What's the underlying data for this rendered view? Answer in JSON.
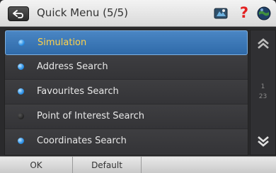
{
  "header": {
    "title": "Quick Menu (5/5)",
    "help_glyph": "?"
  },
  "menu": {
    "items": [
      {
        "label": "Simulation",
        "selected": true,
        "enabled": true
      },
      {
        "label": "Address Search",
        "selected": false,
        "enabled": true
      },
      {
        "label": "Favourites Search",
        "selected": false,
        "enabled": true
      },
      {
        "label": "Point of Interest Search",
        "selected": false,
        "enabled": false
      },
      {
        "label": "Coordinates Search",
        "selected": false,
        "enabled": true
      }
    ]
  },
  "scroll": {
    "current_page": "1",
    "total_pages": "23"
  },
  "bottom": {
    "ok_label": "OK",
    "default_label": "Default"
  },
  "colors": {
    "selected_bg": "#3a78b8",
    "selected_text": "#ffd24a",
    "bullet_on": "#2a8fe6",
    "help": "#e32020"
  }
}
